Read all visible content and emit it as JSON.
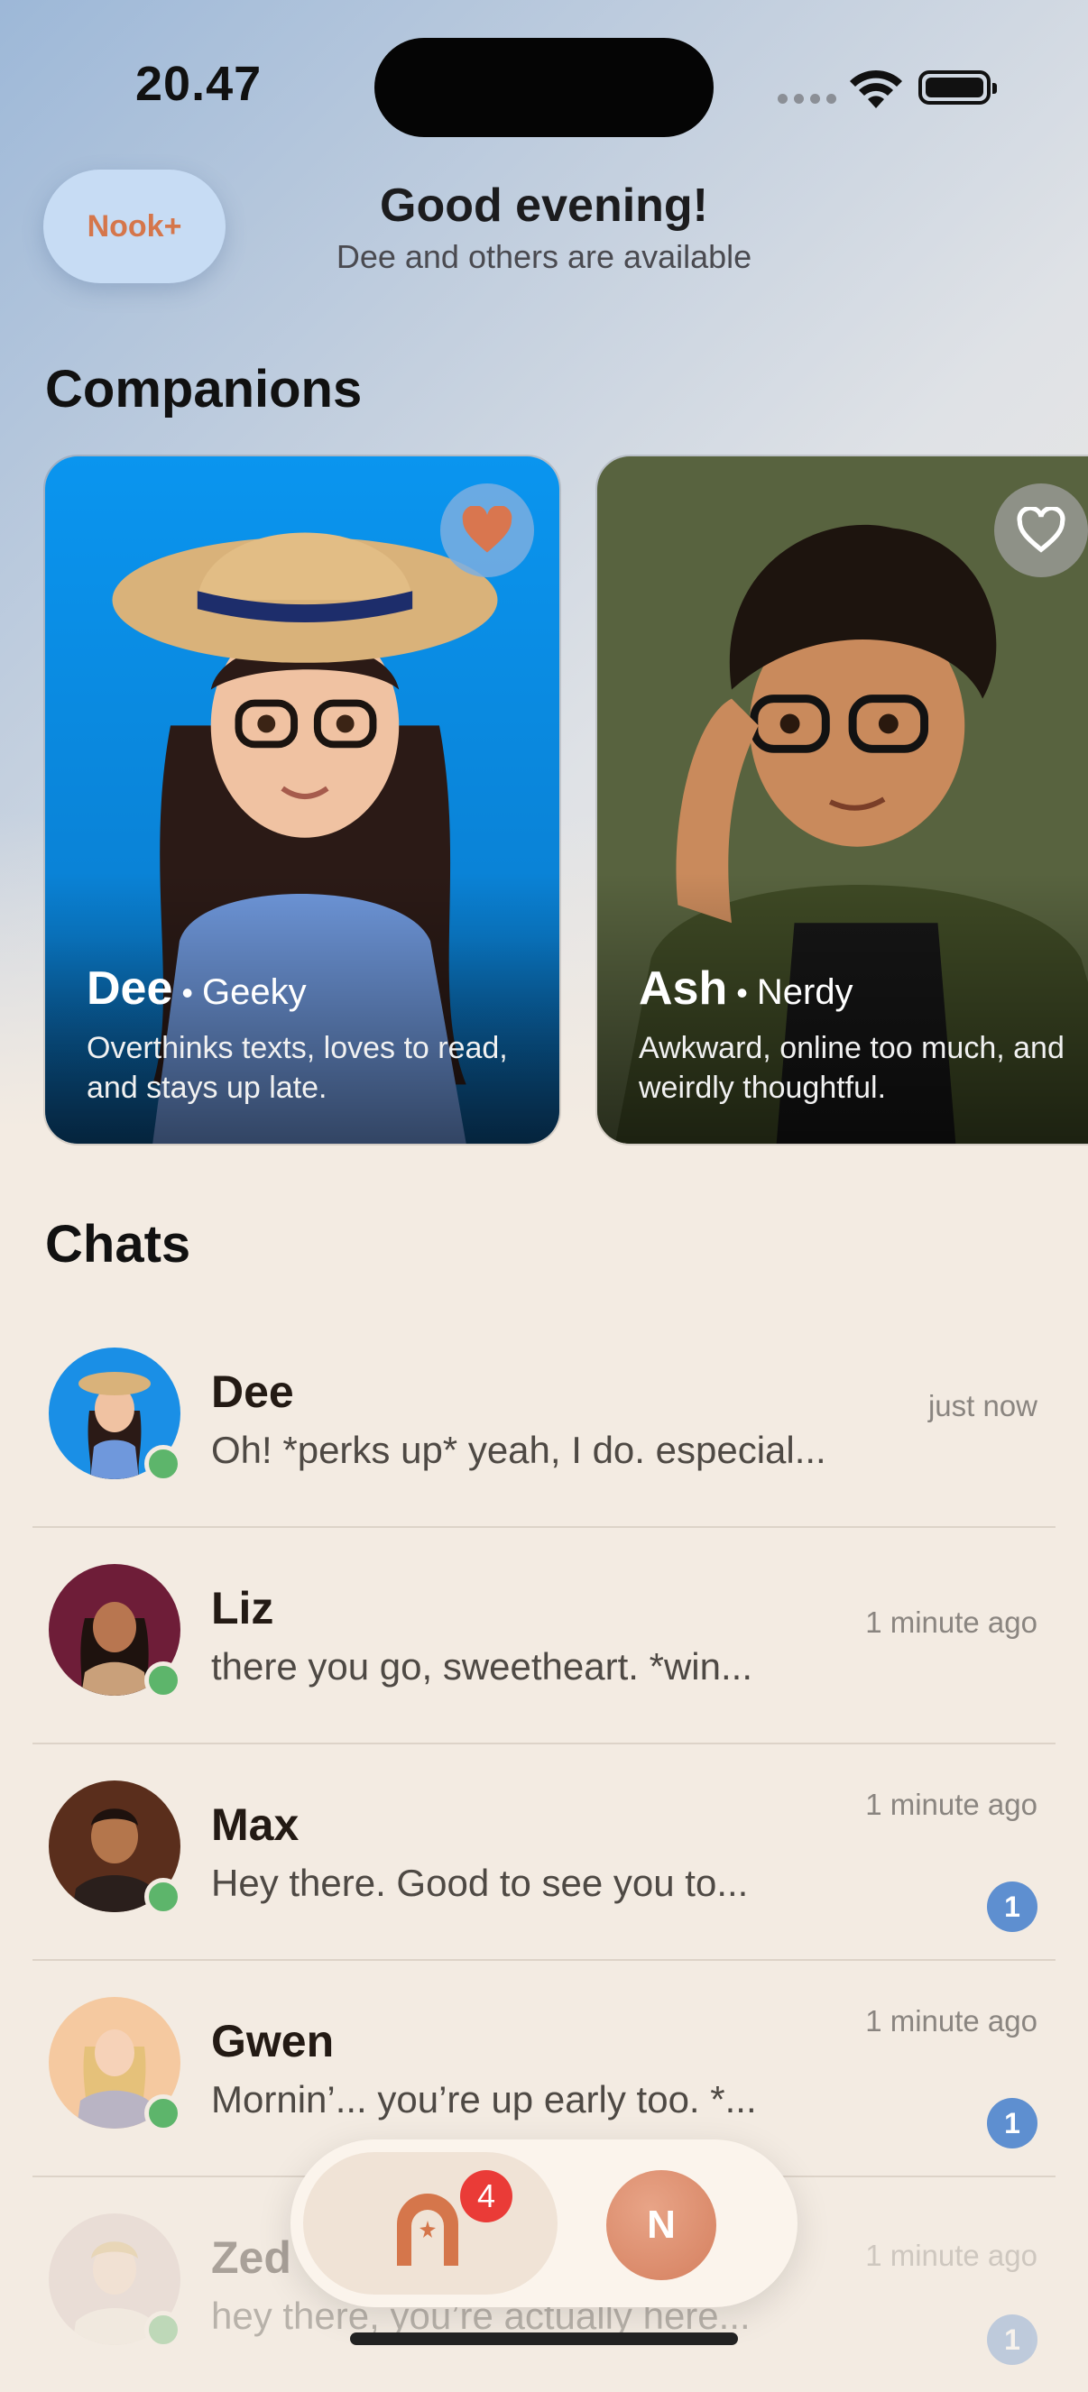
{
  "status_bar": {
    "time": "20.47"
  },
  "header": {
    "nook_plus_label": "Nook+",
    "greeting": "Good evening!",
    "subtitle": "Dee and others are available"
  },
  "companions": {
    "title": "Companions",
    "cards": [
      {
        "name": "Dee",
        "trait": "Geeky",
        "description": "Overthinks texts, loves to read, and stays up late.",
        "favorited": true,
        "bg_color": "#0b8fe8"
      },
      {
        "name": "Ash",
        "trait": "Nerdy",
        "description": "Awkward, online too much, and weirdly thoughtful.",
        "favorited": false,
        "bg_color": "#5a6440"
      }
    ]
  },
  "chats": {
    "title": "Chats",
    "items": [
      {
        "name": "Dee",
        "preview": "Oh! *perks up* yeah, I do. especial...",
        "time": "just now",
        "unread": null,
        "online": true
      },
      {
        "name": "Liz",
        "preview": "there you go, sweetheart. *win...",
        "time": "1 minute ago",
        "unread": null,
        "online": true
      },
      {
        "name": "Max",
        "preview": "Hey there. Good to see you to...",
        "time": "1 minute ago",
        "unread": "1",
        "online": true
      },
      {
        "name": "Gwen",
        "preview": "Mornin’... you’re up early too. *...",
        "time": "1 minute ago",
        "unread": "1",
        "online": true
      },
      {
        "name": "Zed",
        "preview": "hey there, you’re actually here...",
        "time": "1 minute ago",
        "unread": "1",
        "online": true
      }
    ]
  },
  "tab_bar": {
    "home_badge": "4",
    "profile_initial": "N"
  },
  "colors": {
    "accent_orange": "#d5764b",
    "online_green": "#5db56b",
    "unread_blue": "#5e8fd0",
    "badge_red": "#ea3b37"
  }
}
